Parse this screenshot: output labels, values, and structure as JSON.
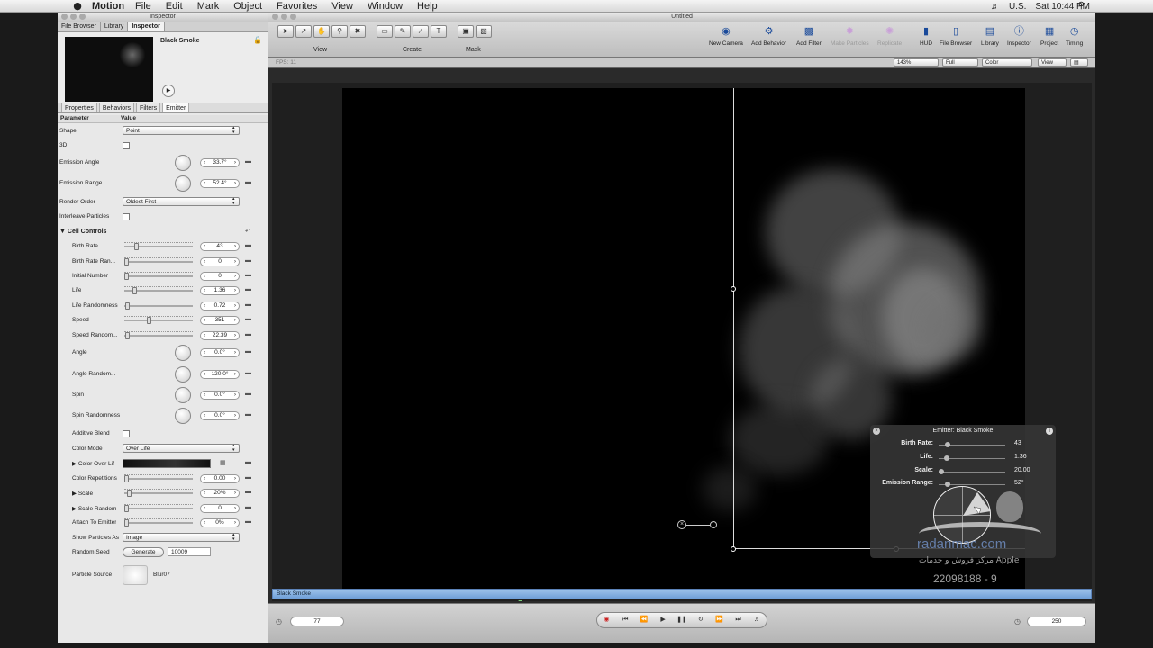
{
  "menubar": {
    "app_name": "Motion",
    "menus": [
      "File",
      "Edit",
      "Mark",
      "Object",
      "Favorites",
      "View",
      "Window",
      "Help"
    ],
    "locale": "U.S.",
    "clock": "Sat 10:44 PM"
  },
  "inspector": {
    "window_title": "Inspector",
    "top_tabs": [
      "File Browser",
      "Library",
      "Inspector"
    ],
    "object_name": "Black Smoke",
    "sub_tabs": [
      "Properties",
      "Behaviors",
      "Filters",
      "Emitter"
    ],
    "col_parameter": "Parameter",
    "col_value": "Value",
    "shape": {
      "label": "Shape",
      "value": "Point"
    },
    "three_d": {
      "label": "3D"
    },
    "emission_angle": {
      "label": "Emission Angle",
      "value": "33.7°"
    },
    "emission_range": {
      "label": "Emission Range",
      "value": "52.4°"
    },
    "render_order": {
      "label": "Render Order",
      "value": "Oldest First"
    },
    "interleave": {
      "label": "Interleave Particles"
    },
    "cell_controls": "Cell Controls",
    "birth_rate": {
      "label": "Birth Rate",
      "value": "43",
      "level": 0.15
    },
    "birth_rate_rand": {
      "label": "Birth Rate Ran...",
      "value": "0",
      "level": 0
    },
    "initial_number": {
      "label": "Initial Number",
      "value": "0",
      "level": 0
    },
    "life": {
      "label": "Life",
      "value": "1.36",
      "level": 0.13
    },
    "life_randomness": {
      "label": "Life Randomness",
      "value": "0.72",
      "level": 0.02
    },
    "speed": {
      "label": "Speed",
      "value": "351",
      "level": 0.35
    },
    "speed_random": {
      "label": "Speed Random...",
      "value": "22.39",
      "level": 0.02
    },
    "angle": {
      "label": "Angle",
      "value": "0.0°"
    },
    "angle_random": {
      "label": "Angle Random...",
      "value": "120.0°"
    },
    "spin": {
      "label": "Spin",
      "value": "0.0°"
    },
    "spin_randomness": {
      "label": "Spin Randomness",
      "value": "0.0°"
    },
    "additive_blend": {
      "label": "Additive Blend"
    },
    "color_mode": {
      "label": "Color Mode",
      "value": "Over Life"
    },
    "color_over_life": {
      "label": "Color Over Lif"
    },
    "color_repetitions": {
      "label": "Color Repetitions",
      "value": "0.00",
      "level": 0
    },
    "scale": {
      "label": "Scale",
      "value": "20%",
      "level": 0.04
    },
    "scale_random": {
      "label": "Scale Random",
      "value": "0",
      "level": 0
    },
    "attach_to_emitter": {
      "label": "Attach To Emitter",
      "value": "0%",
      "level": 0
    },
    "show_particles_as": {
      "label": "Show Particles As",
      "value": "Image"
    },
    "random_seed": {
      "label": "Random Seed",
      "button": "Generate",
      "value": "10009"
    },
    "particle_source": {
      "label": "Particle Source",
      "value": "Blur07"
    }
  },
  "canvas": {
    "window_title": "Untitled",
    "tool_groups": [
      "View",
      "Create",
      "Mask"
    ],
    "tools": [
      "New Camera",
      "Add Behavior",
      "Add Filter",
      "Make Particles",
      "Replicate",
      "HUD",
      "File Browser",
      "Library",
      "Inspector",
      "Project",
      "Timing"
    ],
    "fps": "FPS: 11",
    "zoom": "143%",
    "resolution": "Full",
    "channel": "Color",
    "view_menu": "View"
  },
  "hud": {
    "title": "Emitter: Black Smoke",
    "rows": [
      {
        "label": "Birth Rate:",
        "value": "43",
        "level": 0.1
      },
      {
        "label": "Life:",
        "value": "1.36",
        "level": 0.09
      },
      {
        "label": "Scale:",
        "value": "20.00",
        "level": 0.0
      },
      {
        "label": "Emission Range:",
        "value": "52°",
        "level": 0.1
      }
    ]
  },
  "watermark": {
    "brand": "radanmac.com",
    "arabic": "مرکز فروش و خدمات Apple",
    "phone": "22098188 - 9"
  },
  "timeline": {
    "layer": "Black Smoke"
  },
  "transport": {
    "current_frame": "77",
    "end_frame": "250"
  }
}
